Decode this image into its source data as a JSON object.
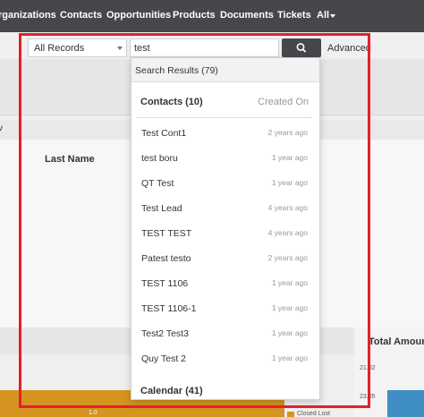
{
  "nav": {
    "items": [
      "rganizations",
      "Contacts",
      "Opportunities",
      "Products",
      "Documents",
      "Tickets",
      "All"
    ]
  },
  "background": {
    "last_name_label": "Last Name",
    "partial_w": "v",
    "total_amount_partial": "Total Amount b",
    "axis_tick_1": "21.02",
    "axis_tick_2": "23.05",
    "bar_value": "1.0",
    "legend_label": "Closed Lost"
  },
  "search": {
    "scope_value": "All Records",
    "query": "test",
    "advanced_label": "Advanced",
    "button_icon": "search-icon"
  },
  "results": {
    "header": "Search Results (79)",
    "sections": [
      {
        "title": "Contacts (10)",
        "aside": "Created On",
        "rows": [
          {
            "name": "Test Cont1",
            "time": "2 years ago"
          },
          {
            "name": "test boru",
            "time": "1 year ago"
          },
          {
            "name": "QT Test",
            "time": "1 year ago"
          },
          {
            "name": "Test Lead",
            "time": "4 years ago"
          },
          {
            "name": "TEST TEST",
            "time": "4 years ago"
          },
          {
            "name": "Patest testo",
            "time": "2 years ago"
          },
          {
            "name": "TEST 1106",
            "time": "1 year ago"
          },
          {
            "name": "TEST 1106-1",
            "time": "1 year ago"
          },
          {
            "name": "Test2 Test3",
            "time": "1 year ago"
          },
          {
            "name": "Quy Test 2",
            "time": "1 year ago"
          }
        ]
      },
      {
        "title": "Calendar (41)"
      }
    ]
  },
  "colors": {
    "nav_bg": "#45474a",
    "highlight_frame": "#e2202b",
    "bar_orange": "#d4941f"
  }
}
